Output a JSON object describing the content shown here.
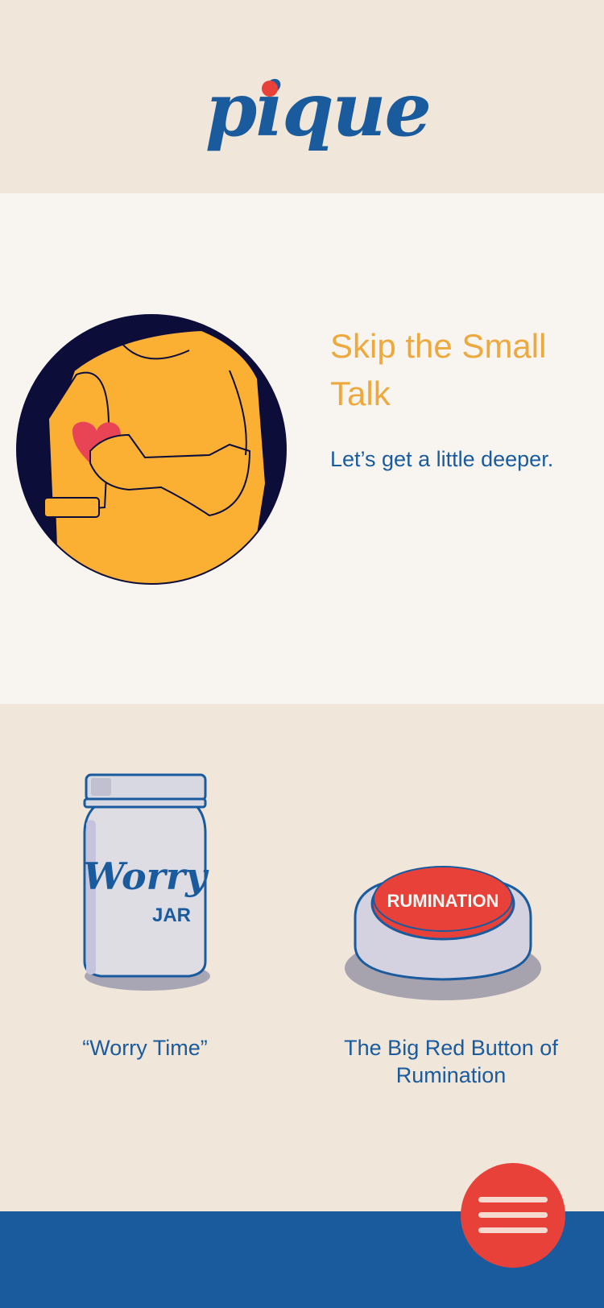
{
  "brand": {
    "name": "pique",
    "colors": {
      "blue": "#1a5b9e",
      "red": "#e8413a",
      "yellow": "#eda93e",
      "cream": "#f0e6d9",
      "off_white": "#f8f5f0",
      "navy": "#0d0d3a",
      "shirt_yellow": "#fbb034"
    }
  },
  "hero": {
    "title": "Skip the Small Talk",
    "subtitle": "Let’s get a little deeper."
  },
  "cards": [
    {
      "label": "“Worry Time”",
      "art_text_script": "Worry",
      "art_text_small": "JAR"
    },
    {
      "label": "The Big Red Button of Rumination",
      "art_text": "RUMINATION"
    }
  ],
  "menu": {
    "icon": "hamburger-menu-icon"
  }
}
